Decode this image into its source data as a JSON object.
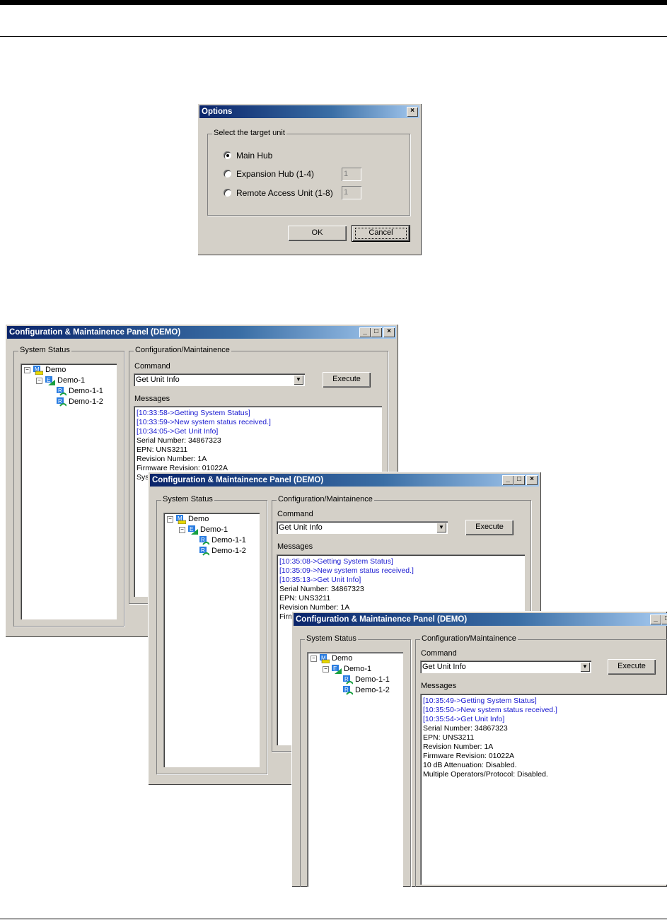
{
  "options_dialog": {
    "title": "Options",
    "group_title": "Select the target unit",
    "radios": [
      {
        "label": "Main Hub",
        "selected": true
      },
      {
        "label": "Expansion Hub (1-4)",
        "selected": false,
        "value": "1"
      },
      {
        "label": "Remote Access Unit (1-8)",
        "selected": false,
        "value": "1"
      }
    ],
    "ok_label": "OK",
    "cancel_label": "Cancel"
  },
  "panel_common": {
    "title": "Configuration & Maintainence Panel (DEMO)",
    "system_status_label": "System Status",
    "config_label": "Configuration/Maintainence",
    "command_label": "Command",
    "command_value": "Get Unit Info",
    "execute_label": "Execute",
    "messages_label": "Messages",
    "tree": [
      "Demo",
      "Demo-1",
      "Demo-1-1",
      "Demo-1-2"
    ],
    "minimize_glyph": "_",
    "maximize_glyph": "□",
    "close_glyph": "×",
    "expand_glyph": "−"
  },
  "panels": [
    {
      "messages": [
        {
          "text": "[10:33:58->Getting System Status]",
          "color": "#1a1ad0"
        },
        {
          "text": "[10:33:59->New system status received.]",
          "color": "#1a1ad0"
        },
        {
          "text": "[10:34:05->Get Unit Info]",
          "color": "#1a1ad0"
        },
        {
          "text": "Serial Number: 34867323",
          "color": "#000000"
        },
        {
          "text": "EPN: UNS3211",
          "color": "#000000"
        },
        {
          "text": "Revision Number: 1A",
          "color": "#000000"
        },
        {
          "text": "Firmware Revision: 01022A",
          "color": "#000000"
        },
        {
          "text": "Sys",
          "color": "#000000"
        }
      ]
    },
    {
      "messages": [
        {
          "text": "[10:35:08->Getting System Status]",
          "color": "#1a1ad0"
        },
        {
          "text": "[10:35:09->New system status received.]",
          "color": "#1a1ad0"
        },
        {
          "text": "[10:35:13->Get Unit Info]",
          "color": "#1a1ad0"
        },
        {
          "text": "Serial Number: 34867323",
          "color": "#000000"
        },
        {
          "text": "EPN: UNS3211",
          "color": "#000000"
        },
        {
          "text": "Revision Number: 1A",
          "color": "#000000"
        },
        {
          "text": "Firm",
          "color": "#000000"
        }
      ]
    },
    {
      "messages": [
        {
          "text": "[10:35:49->Getting System Status]",
          "color": "#1a1ad0"
        },
        {
          "text": "[10:35:50->New system status received.]",
          "color": "#1a1ad0"
        },
        {
          "text": "[10:35:54->Get Unit Info]",
          "color": "#1a1ad0"
        },
        {
          "text": "Serial Number: 34867323",
          "color": "#000000"
        },
        {
          "text": "EPN: UNS3211",
          "color": "#000000"
        },
        {
          "text": "Revision Number: 1A",
          "color": "#000000"
        },
        {
          "text": "Firmware Revision: 01022A",
          "color": "#000000"
        },
        {
          "text": "10 dB Attenuation: Disabled.",
          "color": "#000000"
        },
        {
          "text": "Multiple Operators/Protocol: Disabled.",
          "color": "#000000"
        }
      ]
    }
  ]
}
